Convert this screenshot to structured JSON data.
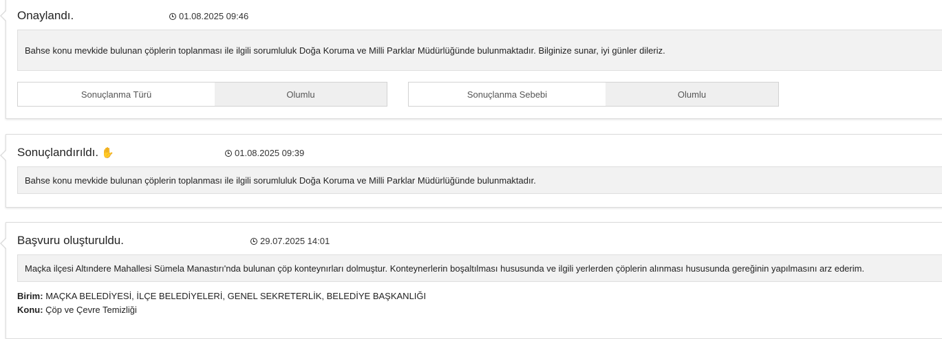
{
  "entries": [
    {
      "status": "Onaylandı.",
      "datetime": "01.08.2025 09:46",
      "message": "Bahse konu mevkide bulunan çöplerin toplanması ile ilgili sorumluluk Doğa Koruma ve Milli Parklar Müdürlüğünde bulunmaktadır. Bilginize sunar, iyi günler dileriz.",
      "fields": [
        {
          "label": "Sonuçlanma Türü",
          "value": "Olumlu"
        },
        {
          "label": "Sonuçlanma Sebebi",
          "value": "Olumlu"
        }
      ]
    },
    {
      "status": "Sonuçlandırıldı.",
      "icon": "hand-icon",
      "datetime": "01.08.2025 09:39",
      "message": "Bahse konu mevkide bulunan çöplerin toplanması ile ilgili sorumluluk Doğa Koruma ve Milli Parklar Müdürlüğünde bulunmaktadır."
    },
    {
      "status": "Başvuru oluşturuldu.",
      "datetime": "29.07.2025 14:01",
      "message": "Maçka ilçesi Altındere Mahallesi Sümela Manastırı'nda bulunan çöp konteynırları dolmuştur. Konteynerlerin boşaltılması hususunda ve ilgili yerlerden çöplerin alınması hususunda gereğinin yapılmasını arz ederim.",
      "meta": [
        {
          "label": "Birim:",
          "value": "MAÇKA BELEDİYESİ, İLÇE BELEDİYELERİ, GENEL SEKRETERLİK, BELEDİYE BAŞKANLIĞI"
        },
        {
          "label": "Konu:",
          "value": "Çöp ve Çevre Temizliği"
        }
      ]
    }
  ]
}
